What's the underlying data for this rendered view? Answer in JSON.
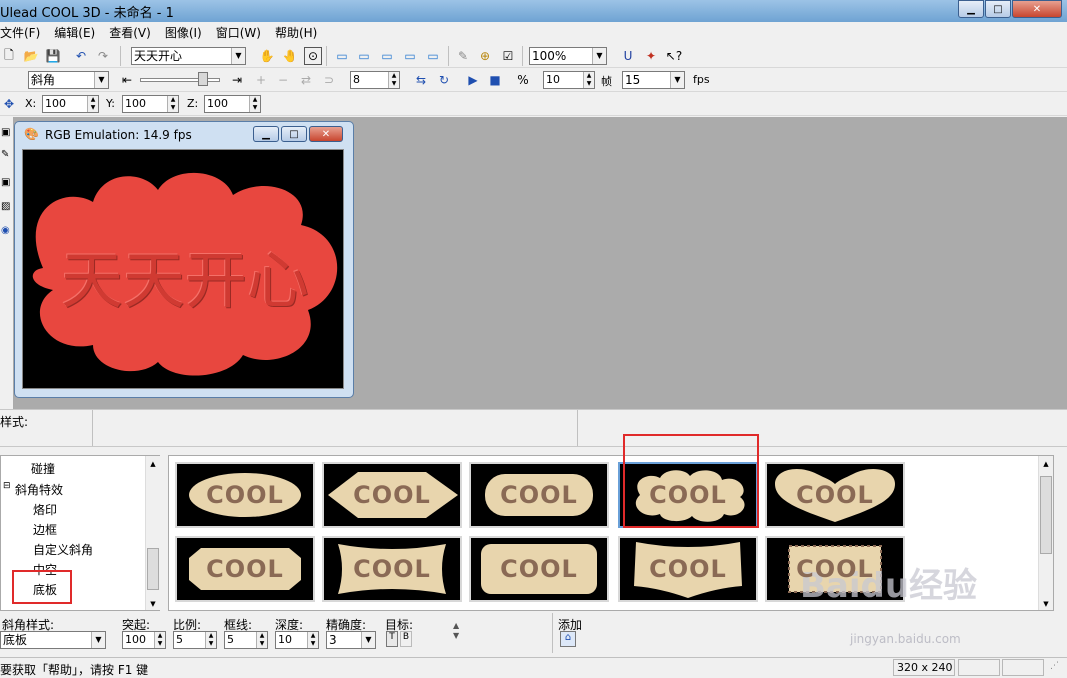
{
  "window": {
    "title": "Ulead COOL 3D - 未命名 - 1"
  },
  "menu": [
    "文件(F)",
    "编辑(E)",
    "查看(V)",
    "图像(I)",
    "窗口(W)",
    "帮助(H)"
  ],
  "toolbar1": {
    "text_combo": "天天开心",
    "zoom": "100%"
  },
  "toolbar2": {
    "bevel_combo": "斜角",
    "value1": "8",
    "value2": "10",
    "frames_label": "帧",
    "frames": "15",
    "fps": "fps"
  },
  "toolbar3": {
    "x_label": "X:",
    "x": "100",
    "y_label": "Y:",
    "y": "100",
    "z_label": "Z:",
    "z": "100"
  },
  "child_window": {
    "title": "RGB Emulation: 14.9 fps",
    "text": "天天开心"
  },
  "infobar": {
    "style_label": "样式:"
  },
  "tree": {
    "items": [
      "碰撞",
      "斜角特效",
      "烙印",
      "边框",
      "自定义斜角",
      "中空",
      "底板"
    ]
  },
  "gallery": {
    "thumb_text": "COOL"
  },
  "properties": {
    "bevel_style_label": "斜角样式:",
    "bevel_style_value": "底板",
    "bulge_label": "突起:",
    "bulge": "100",
    "ratio_label": "比例:",
    "ratio": "5",
    "frame_label": "框线:",
    "frame": "5",
    "depth_label": "深度:",
    "depth": "10",
    "precision_label": "精确度:",
    "precision": "3",
    "target_label": "目标:",
    "target_t": "T",
    "target_b": "B",
    "add_label": "添加"
  },
  "status": {
    "help_text": "要获取「帮助」，请按 F1 键",
    "resolution": "320 x 240"
  },
  "watermark": {
    "brand": "Baidu经验",
    "url": "jingyan.baidu.com"
  },
  "colors": {
    "accent": "#e8473f",
    "highlight": "#e02a2a",
    "plate": "#e8d5ad",
    "cooltext": "#8a6a55"
  }
}
